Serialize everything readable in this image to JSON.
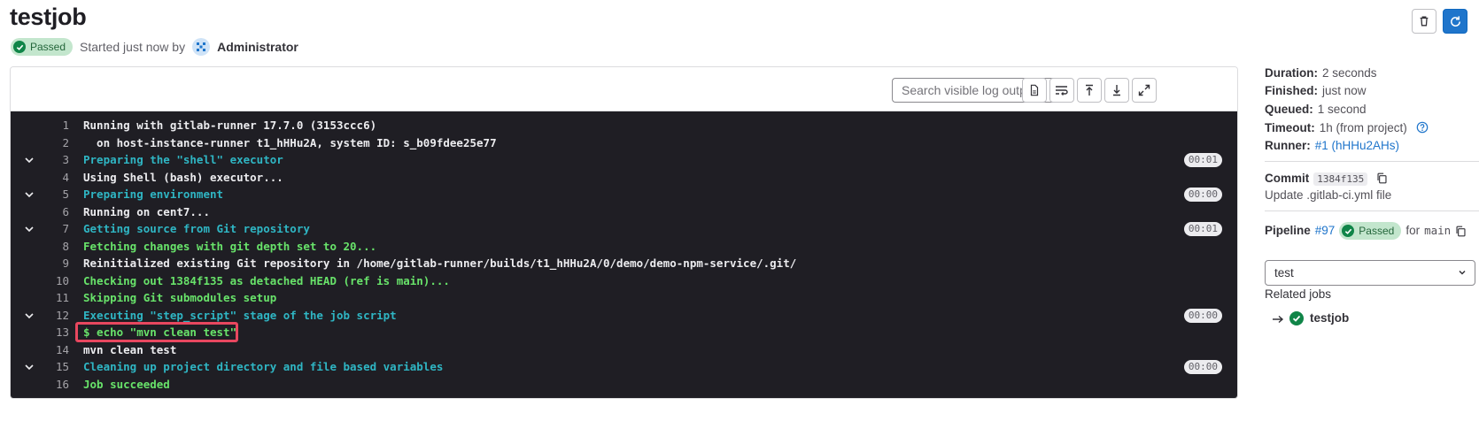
{
  "header": {
    "title": "testjob",
    "status_badge": "Passed",
    "started_text": "Started just now by",
    "user": "Administrator"
  },
  "toolbar": {
    "search_placeholder": "Search visible log output"
  },
  "log": [
    {
      "n": "1",
      "text": "Running with gitlab-runner 17.7.0 (3153ccc6)",
      "color": "white",
      "section": false
    },
    {
      "n": "2",
      "text": "  on host-instance-runner t1_hHHu2A, system ID: s_b09fdee25e77",
      "color": "white",
      "section": false
    },
    {
      "n": "3",
      "text": "Preparing the \"shell\" executor",
      "color": "cyan",
      "section": true,
      "dur": "00:01"
    },
    {
      "n": "4",
      "text": "Using Shell (bash) executor...",
      "color": "white",
      "section": false
    },
    {
      "n": "5",
      "text": "Preparing environment",
      "color": "cyan",
      "section": true,
      "dur": "00:00"
    },
    {
      "n": "6",
      "text": "Running on cent7...",
      "color": "white",
      "section": false
    },
    {
      "n": "7",
      "text": "Getting source from Git repository",
      "color": "cyan",
      "section": true,
      "dur": "00:01"
    },
    {
      "n": "8",
      "text": "Fetching changes with git depth set to 20...",
      "color": "green",
      "section": false
    },
    {
      "n": "9",
      "text": "Reinitialized existing Git repository in /home/gitlab-runner/builds/t1_hHHu2A/0/demo/demo-npm-service/.git/",
      "color": "white",
      "section": false
    },
    {
      "n": "10",
      "text": "Checking out 1384f135 as detached HEAD (ref is main)...",
      "color": "green",
      "section": false
    },
    {
      "n": "11",
      "text": "Skipping Git submodules setup",
      "color": "green",
      "section": false
    },
    {
      "n": "12",
      "text": "Executing \"step_script\" stage of the job script",
      "color": "cyan",
      "section": true,
      "dur": "00:00"
    },
    {
      "n": "13",
      "text": "$ echo \"mvn clean test\"",
      "color": "green",
      "section": false,
      "highlight": true
    },
    {
      "n": "14",
      "text": "mvn clean test",
      "color": "white",
      "section": false
    },
    {
      "n": "15",
      "text": "Cleaning up project directory and file based variables",
      "color": "cyan",
      "section": true,
      "dur": "00:00"
    },
    {
      "n": "16",
      "text": "Job succeeded",
      "color": "green",
      "section": false
    }
  ],
  "sidebar": {
    "duration_label": "Duration:",
    "duration_value": "2 seconds",
    "finished_label": "Finished:",
    "finished_value": "just now",
    "queued_label": "Queued:",
    "queued_value": "1 second",
    "timeout_label": "Timeout:",
    "timeout_value": "1h (from project)",
    "runner_label": "Runner:",
    "runner_value": "#1 (hHHu2AHs)",
    "commit_label": "Commit",
    "commit_sha": "1384f135",
    "commit_message": "Update .gitlab-ci.yml file",
    "pipeline_label": "Pipeline",
    "pipeline_id": "#97",
    "pipeline_status": "Passed",
    "pipeline_for": "for",
    "pipeline_ref": "main",
    "stage_select": "test",
    "related_jobs_label": "Related jobs",
    "related_job_name": "testjob"
  },
  "colors": {
    "accent": "#1f75cb",
    "success": "#108548",
    "log_bg": "#1f1e24",
    "highlight": "#e8475f"
  }
}
